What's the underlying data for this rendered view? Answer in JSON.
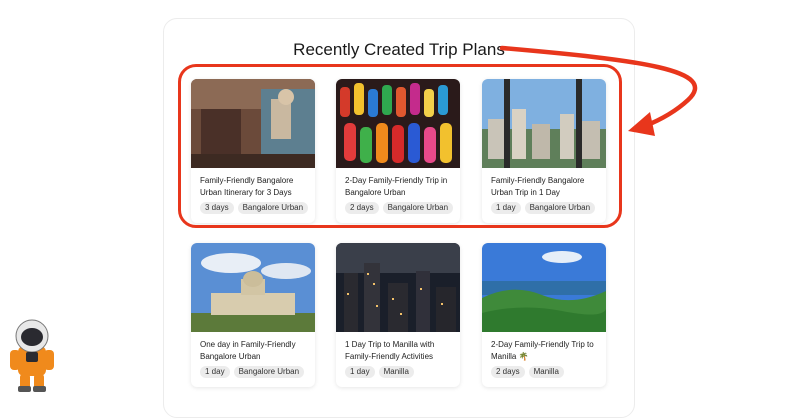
{
  "section": {
    "title": "Recently Created Trip Plans"
  },
  "colors": {
    "highlight": "#e8361c",
    "tag_bg": "#ececec"
  },
  "cards": [
    {
      "title": "Family-Friendly Bangalore Urban Itinerary for 3 Days",
      "tags": [
        "3 days",
        "Bangalore Urban"
      ],
      "image": "street-mural-photo"
    },
    {
      "title": "2-Day Family-Friendly Trip in Bangalore Urban",
      "tags": [
        "2 days",
        "Bangalore Urban"
      ],
      "image": "wooden-dolls-photo"
    },
    {
      "title": "Family-Friendly Bangalore Urban Trip in 1 Day",
      "tags": [
        "1 day",
        "Bangalore Urban"
      ],
      "image": "city-skyline-window-photo"
    },
    {
      "title": "One day in Family-Friendly Bangalore Urban",
      "tags": [
        "1 day",
        "Bangalore Urban"
      ],
      "image": "vidhana-soudha-photo"
    },
    {
      "title": "1 Day Trip to Manilla with Family-Friendly Activities",
      "tags": [
        "1 day",
        "Manilla"
      ],
      "image": "night-city-photo"
    },
    {
      "title": "2-Day Family-Friendly Trip to Manilla 🌴",
      "tags": [
        "2 days",
        "Manilla"
      ],
      "image": "green-hills-coast-photo"
    }
  ]
}
